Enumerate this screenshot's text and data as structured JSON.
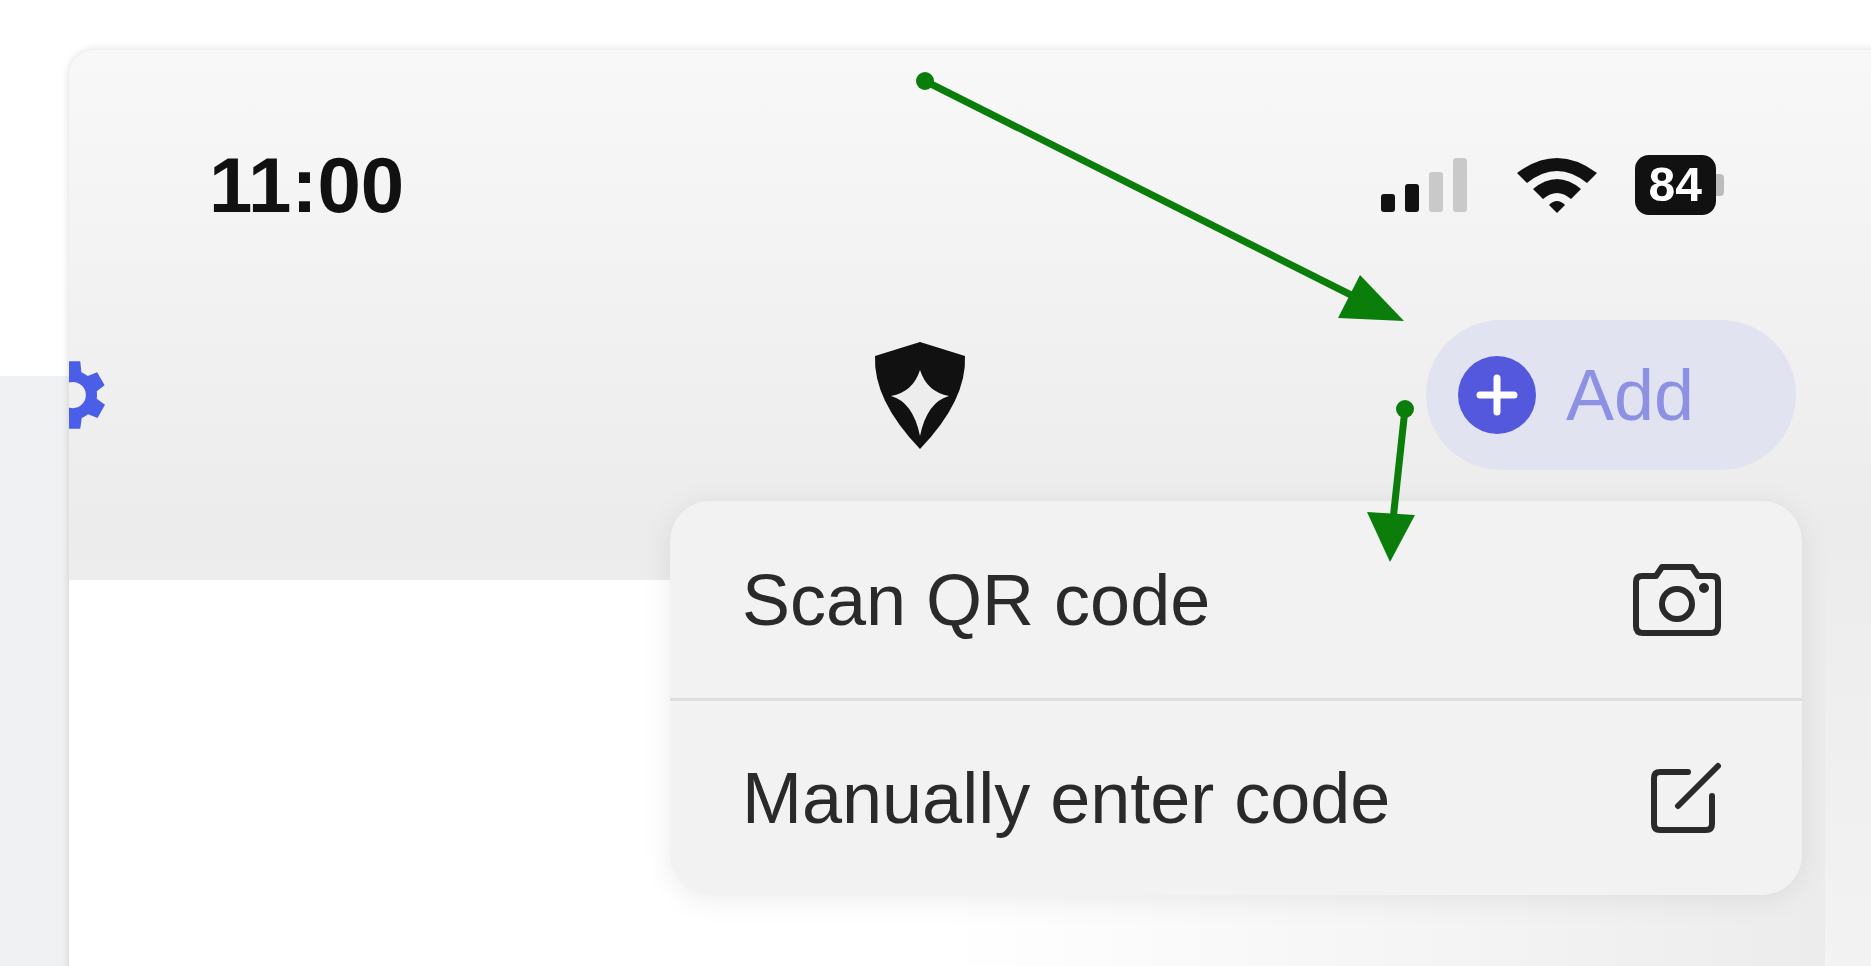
{
  "status_bar": {
    "time": "11:00",
    "battery": "84"
  },
  "header": {
    "add_button": {
      "label": "Add"
    }
  },
  "menu": {
    "items": [
      {
        "label": "Scan QR code",
        "kind": "camera"
      },
      {
        "label": "Manually enter code",
        "kind": "edit"
      }
    ]
  }
}
